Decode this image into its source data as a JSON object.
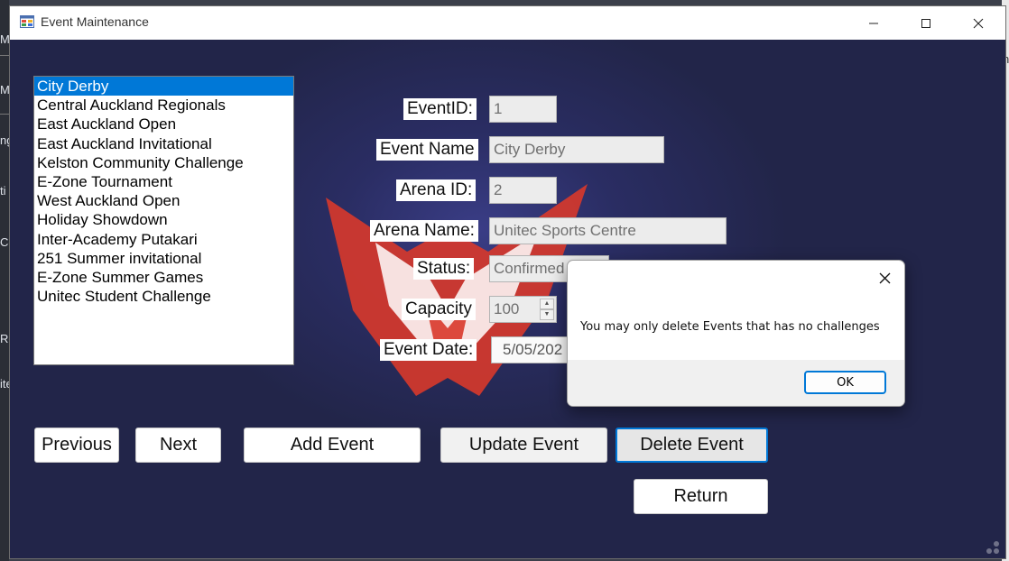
{
  "window": {
    "title": "Event Maintenance"
  },
  "events_list": [
    "City Derby",
    "Central Auckland Regionals",
    "East Auckland Open",
    "East Auckland Invitational",
    "Kelston Community Challenge",
    "E-Zone Tournament",
    "West Auckland Open",
    "Holiday Showdown",
    "Inter-Academy Putakari",
    "251 Summer invitational",
    "E-Zone Summer Games",
    "Unitec Student Challenge"
  ],
  "selected_index": 0,
  "form": {
    "event_id_label": "EventID:",
    "event_id_value": "1",
    "event_name_label": "Event Name",
    "event_name_value": "City Derby",
    "arena_id_label": "Arena ID:",
    "arena_id_value": "2",
    "arena_name_label": "Arena Name:",
    "arena_name_value": "Unitec Sports Centre",
    "status_label": "Status:",
    "status_value": "Confirmed",
    "capacity_label": "Capacity",
    "capacity_value": "100",
    "event_date_label": "Event Date:",
    "event_date_value": "5/05/202"
  },
  "buttons": {
    "previous": "Previous",
    "next": "Next",
    "add": "Add Event",
    "update": "Update Event",
    "delete": "Delete Event",
    "return": "Return"
  },
  "dialog": {
    "message": "You may only delete Events that has no challenges",
    "ok": "OK"
  },
  "background_app": {
    "left_labels": [
      "M",
      "M",
      "ng",
      "ti",
      "Co",
      "Re",
      "ite"
    ],
    "right_label": "n"
  },
  "colors": {
    "selection": "#0078d7",
    "client_bg": "#232646",
    "logo_red": "#d8392b"
  }
}
